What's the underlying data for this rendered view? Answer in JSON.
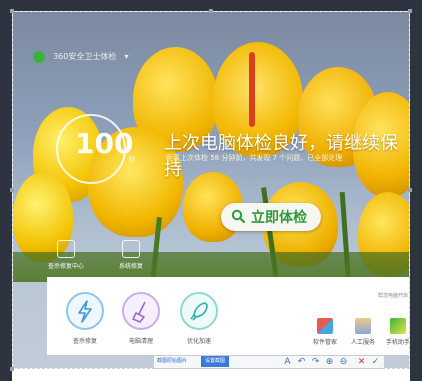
{
  "app": {
    "brand_name": "360安全卫士体检",
    "brand_color": "#3bb33b"
  },
  "checkup": {
    "score": "100",
    "score_unit": "分",
    "headline": "上次电脑体检良好，请继续保持",
    "subline": "距离上次体检 58 分钟前，共发现 7 个问题，已全部处理",
    "check_button_label": "立即体检",
    "check_icon": "search-icon"
  },
  "quick_links": [
    {
      "label": "查杀修复中心",
      "icon": "shield-icon"
    },
    {
      "label": "系统修复",
      "icon": "wrench-icon"
    }
  ],
  "bottom_panel": {
    "hint": "帮您电脑开启",
    "tools": [
      {
        "label": "查杀修复",
        "icon": "lightning-icon",
        "color": "#3b9ad9"
      },
      {
        "label": "电脑清理",
        "icon": "broom-icon",
        "color": "#9a6ad8"
      },
      {
        "label": "优化加速",
        "icon": "rocket-icon",
        "color": "#2bb0a8"
      }
    ],
    "mini_tools": [
      {
        "label": "软件管家",
        "icon": "apps-icon"
      },
      {
        "label": "人工服务",
        "icon": "support-icon"
      },
      {
        "label": "手机助手",
        "icon": "phone-icon"
      }
    ]
  },
  "crop_toolbar": {
    "input_value": "截图原始图片",
    "selected_label": "设置截图",
    "buttons": [
      "A",
      "↶",
      "↷",
      "⊕",
      "⊖",
      "✕",
      "✓"
    ]
  }
}
